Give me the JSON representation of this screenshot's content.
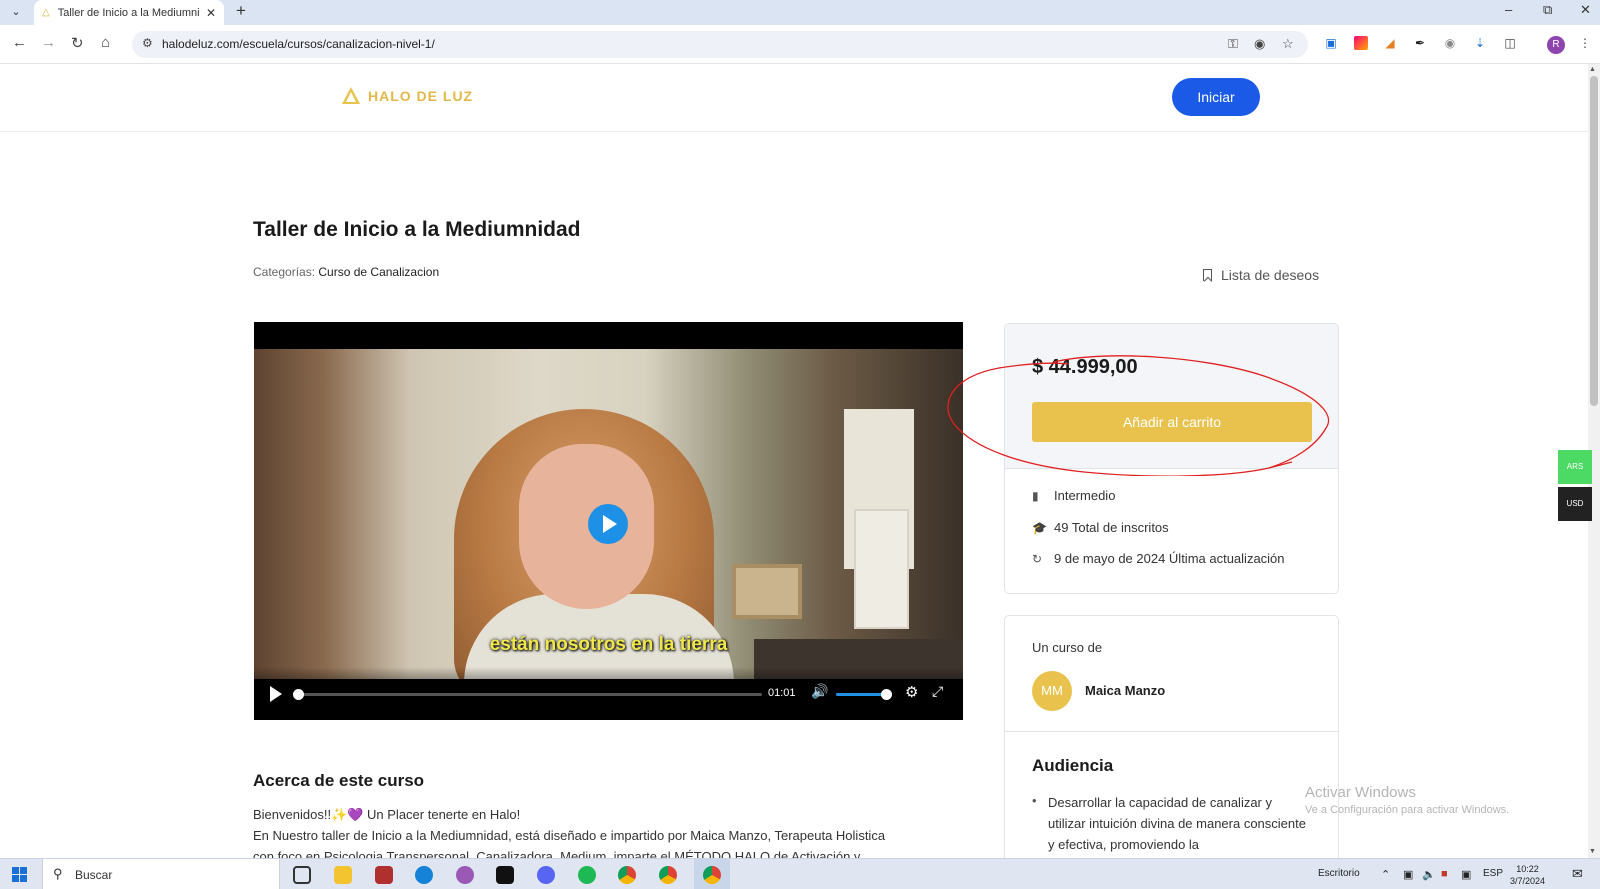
{
  "browser": {
    "tab_title": "Taller de Inicio a la Mediumnidad",
    "new_tab": "+",
    "url": "halodeluz.com/escuela/cursos/canalizacion-nivel-1/"
  },
  "site": {
    "logo_text": "HALO DE LUZ",
    "login_button": "Iniciar"
  },
  "course": {
    "title": "Taller de Inicio a la Mediumnidad",
    "categories_label": "Categorías:",
    "category": "Curso de Canalizacion",
    "wishlist": "Lista de deseos"
  },
  "video": {
    "subtitle": "están nosotros en la tierra",
    "time": "01:01",
    "progress": 0.0,
    "volume": 0.9
  },
  "pricing": {
    "price": "$ 44.999,00",
    "add_to_cart": "Añadir al carrito",
    "level": "Intermedio",
    "enrolled": "49 Total de inscritos",
    "updated": "9 de mayo de 2024 Última actualización",
    "annotation_color": "#e02020"
  },
  "instructor": {
    "heading": "Un curso de",
    "initials": "MM",
    "name": "Maica Manzo"
  },
  "audience": {
    "heading": "Audiencia",
    "items": [
      "Desarrollar la capacidad de canalizar y utilizar intuición divina de manera consciente y efectiva, promoviendo la"
    ]
  },
  "about": {
    "heading": "Acerca de este curso",
    "line1": "Bienvenidos!!✨💜 Un Placer tenerte en Halo!",
    "line2": "En Nuestro taller de Inicio a la Mediumnidad, está diseñado e impartido por Maica Manzo, Terapeuta Holistica",
    "line3": "con foco en Psicologia Transpersonal, Canalizadora, Medium, imparte el MÉTODO HALO de Activación y"
  },
  "currency": {
    "ars": "ARS",
    "usd": "USD"
  },
  "watermark": {
    "title": "Activar Windows",
    "subtitle": "Ve a Configuración para activar Windows."
  },
  "taskbar": {
    "search_placeholder": "Buscar",
    "desktop_label": "Escritorio",
    "language": "ESP",
    "time": "10:22",
    "date": "3/7/2024"
  },
  "colors": {
    "brand_gold": "#e8c24d",
    "primary_blue": "#1a5ae6"
  }
}
